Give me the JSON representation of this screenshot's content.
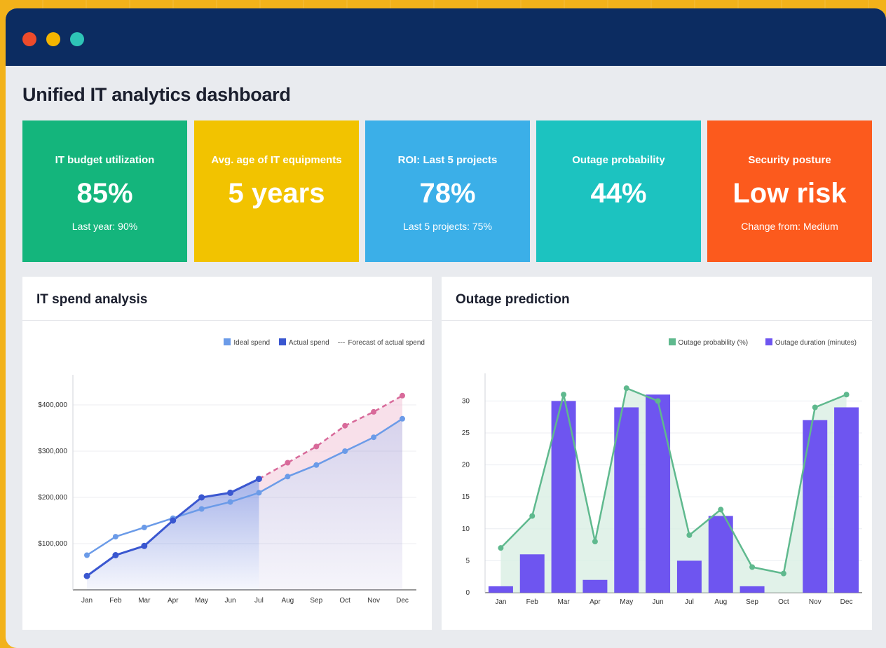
{
  "dashboard": {
    "title": "Unified IT analytics dashboard"
  },
  "kpis": [
    {
      "title": "IT budget utilization",
      "value": "85%",
      "sub": "Last year: 90%",
      "color": "#14b57c"
    },
    {
      "title": "Avg. age of IT equipments",
      "value": "5 years",
      "sub": "",
      "color": "#f2c300"
    },
    {
      "title": "ROI: Last 5 projects",
      "value": "78%",
      "sub": "Last 5 projects: 75%",
      "color": "#3bafe8"
    },
    {
      "title": "Outage probability",
      "value": "44%",
      "sub": "",
      "color": "#1cc3c0"
    },
    {
      "title": "Security posture",
      "value": "Low risk",
      "sub": "Change from: Medium",
      "color": "#fc5a1d"
    }
  ],
  "spend_panel": {
    "title": "IT spend analysis",
    "legend": {
      "ideal": "Ideal spend",
      "actual": "Actual spend",
      "forecast": "Forecast of actual spend"
    }
  },
  "outage_panel": {
    "title": "Outage prediction",
    "legend": {
      "probability": "Outage probability (%)",
      "duration": "Outage duration (minutes)"
    }
  },
  "colors": {
    "titlebar": "#0c2c61",
    "ideal": "#6b9be8",
    "actual": "#3a57d0",
    "forecast": "#d86a9a",
    "prob": "#5fb98e",
    "duration": "#6e55f0"
  },
  "chart_data": [
    {
      "type": "line",
      "title": "IT spend analysis",
      "categories": [
        "Jan",
        "Feb",
        "Mar",
        "Apr",
        "May",
        "Jun",
        "Jul",
        "Aug",
        "Sep",
        "Oct",
        "Nov",
        "Dec"
      ],
      "yticks": [
        "$100,000",
        "$200,000",
        "$300,000",
        "$400,000"
      ],
      "ylim": [
        0,
        450000
      ],
      "series": [
        {
          "name": "Ideal spend",
          "values": [
            75000,
            115000,
            135000,
            155000,
            175000,
            190000,
            210000,
            245000,
            270000,
            300000,
            330000,
            370000
          ]
        },
        {
          "name": "Actual spend",
          "values": [
            30000,
            75000,
            95000,
            150000,
            200000,
            210000,
            240000,
            null,
            null,
            null,
            null,
            null
          ]
        },
        {
          "name": "Forecast of actual spend",
          "values": [
            null,
            null,
            null,
            null,
            null,
            null,
            240000,
            275000,
            310000,
            355000,
            385000,
            420000
          ]
        }
      ],
      "legend": "top-right",
      "grid": true
    },
    {
      "type": "bar",
      "title": "Outage prediction",
      "categories": [
        "Jan",
        "Feb",
        "Mar",
        "Apr",
        "May",
        "Jun",
        "Jul",
        "Aug",
        "Sep",
        "Oct",
        "Nov",
        "Dec"
      ],
      "yticks": [
        "0",
        "5",
        "10",
        "15",
        "20",
        "25",
        "30"
      ],
      "ylim": [
        0,
        33
      ],
      "series": [
        {
          "name": "Outage duration (minutes)",
          "kind": "bar",
          "values": [
            1,
            6,
            30,
            2,
            29,
            31,
            5,
            12,
            1,
            0,
            27,
            29
          ]
        },
        {
          "name": "Outage probability (%)",
          "kind": "line",
          "values": [
            7,
            12,
            31,
            8,
            32,
            30,
            9,
            13,
            4,
            3,
            29,
            31
          ]
        }
      ],
      "legend": "top-right",
      "grid": true
    }
  ]
}
